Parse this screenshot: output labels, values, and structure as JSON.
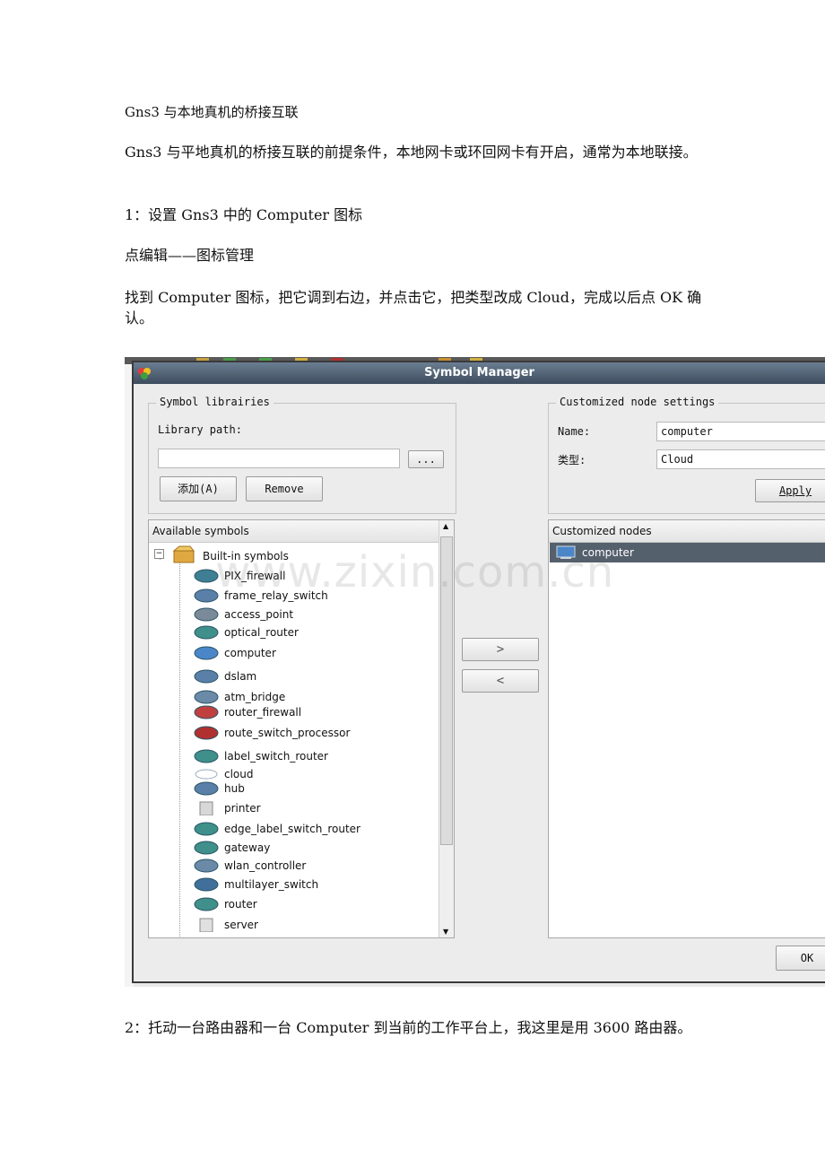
{
  "doc": {
    "title": "Gns3 与本地真机的桥接互联",
    "p1": "Gns3 与平地真机的桥接互联的前提条件，本地网卡或环回网卡有开启，通常为本地联接。",
    "p2": "1：设置 Gns3 中的 Computer 图标",
    "p3": "点编辑——图标管理",
    "p4": "找到 Computer 图标，把它调到右边，并点击它，把类型改成 Cloud，完成以后点 OK 确认。",
    "p5": "2：托动一台路由器和一台 Computer 到当前的工作平台上，我这里是用 3600 路由器。"
  },
  "watermark": "www.zixin.com.cn",
  "dialog": {
    "title": "Symbol Manager",
    "symbol_libs": {
      "legend": "Symbol librairies",
      "path_label": "Library path:",
      "path_value": "",
      "browse": "...",
      "add": "添加(A)",
      "remove": "Remove"
    },
    "available": {
      "header": "Available symbols",
      "root": "Built-in symbols",
      "items": [
        {
          "label": "PIX_firewall",
          "icon": "firewall-icon"
        },
        {
          "label": "frame_relay_switch",
          "icon": "frame-relay-icon"
        },
        {
          "label": "access_point",
          "icon": "access-point-icon"
        },
        {
          "label": "optical_router",
          "icon": "optical-router-icon"
        },
        {
          "label": "computer",
          "icon": "computer-icon"
        },
        {
          "label": "dslam",
          "icon": "dslam-icon"
        },
        {
          "label": "atm_bridge",
          "icon": "atm-bridge-icon"
        },
        {
          "label": "router_firewall",
          "icon": "router-firewall-icon"
        },
        {
          "label": "route_switch_processor",
          "icon": "rsp-icon"
        },
        {
          "label": "label_switch_router",
          "icon": "lsr-icon"
        },
        {
          "label": "cloud",
          "icon": "cloud-icon"
        },
        {
          "label": "hub",
          "icon": "hub-icon"
        },
        {
          "label": "printer",
          "icon": "printer-icon"
        },
        {
          "label": "edge_label_switch_router",
          "icon": "elsr-icon"
        },
        {
          "label": "gateway",
          "icon": "gateway-icon"
        },
        {
          "label": "wlan_controller",
          "icon": "wlan-controller-icon"
        },
        {
          "label": "multilayer_switch",
          "icon": "multilayer-switch-icon"
        },
        {
          "label": "router",
          "icon": "router-icon"
        },
        {
          "label": "server",
          "icon": "server-icon"
        }
      ]
    },
    "move_right": ">",
    "move_left": "<",
    "custom_settings": {
      "legend": "Customized node settings",
      "name_label": "Name:",
      "name_value": "computer",
      "type_label": "类型:",
      "type_value": "Cloud",
      "apply": "Apply"
    },
    "customized": {
      "header": "Customized nodes",
      "items": [
        {
          "label": "computer",
          "icon": "computer-icon"
        }
      ]
    },
    "ok": "OK"
  },
  "colors": {
    "title_bar": "#4f6276",
    "selection": "#55606d",
    "device_blue": "#3f7f94"
  }
}
